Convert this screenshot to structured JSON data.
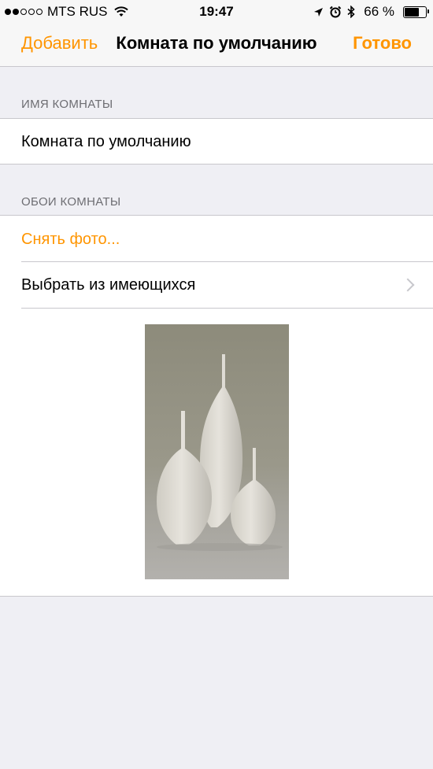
{
  "status_bar": {
    "carrier": "MTS RUS",
    "time": "19:47",
    "battery_percent_text": "66 %",
    "battery_level": 0.66,
    "signal_strength": 2,
    "signal_max": 5,
    "icons": [
      "wifi-icon",
      "location-arrow-icon",
      "alarm-icon",
      "bluetooth-icon",
      "battery-icon"
    ]
  },
  "nav": {
    "left_label": "Добавить",
    "title": "Комната по умолчанию",
    "right_label": "Готово"
  },
  "room_name": {
    "header": "ИМЯ КОМНАТЫ",
    "value": "Комната по умолчанию"
  },
  "wallpaper": {
    "header": "ОБОИ КОМНАТЫ",
    "take_photo": "Снять фото...",
    "choose_existing": "Выбрать из имеющихся",
    "chevron_icon": "chevron-right-icon"
  },
  "colors": {
    "accent": "#ff9500",
    "background": "#efeff4",
    "separator": "#c8c7cc",
    "header_text": "#6d6d72"
  }
}
